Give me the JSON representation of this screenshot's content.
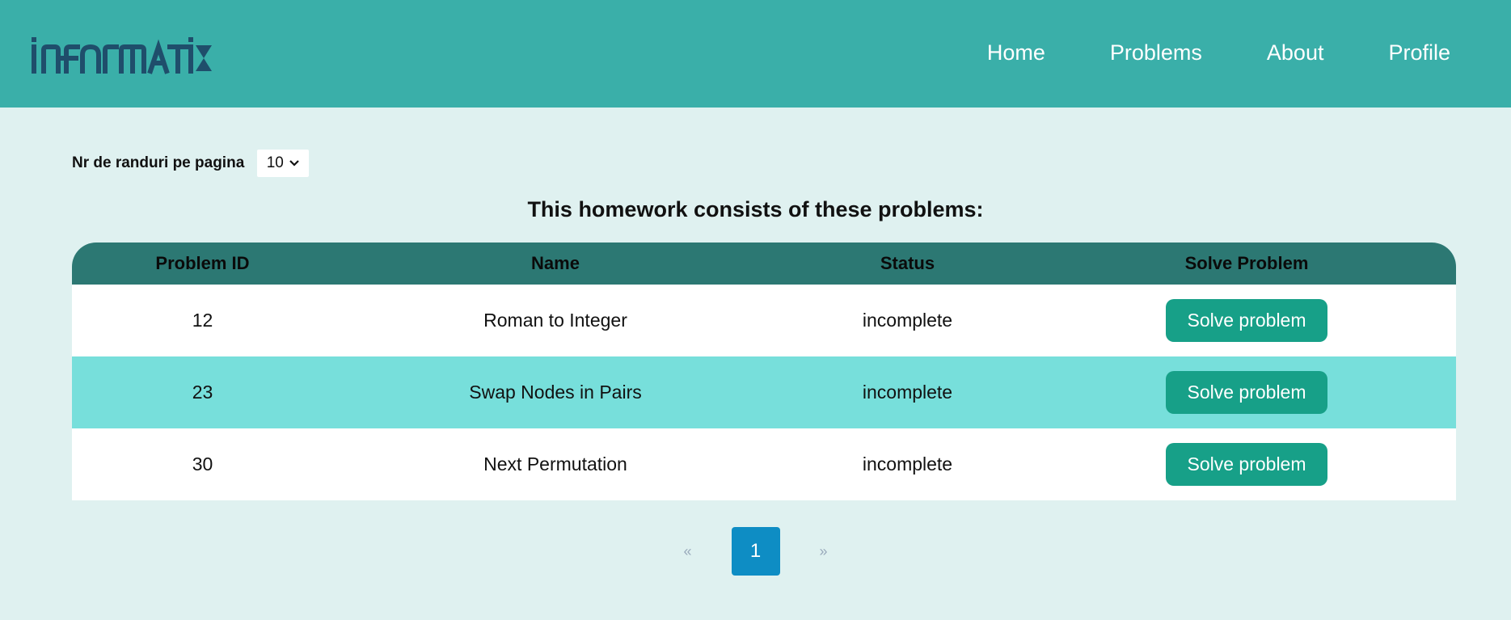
{
  "brand": {
    "logo_text": "informatix"
  },
  "nav": {
    "items": [
      {
        "label": "Home"
      },
      {
        "label": "Problems"
      },
      {
        "label": "About"
      },
      {
        "label": "Profile"
      }
    ]
  },
  "rows_per_page": {
    "label": "Nr de randuri pe pagina",
    "selected": "10"
  },
  "heading": "This homework consists of these problems:",
  "table": {
    "columns": [
      "Problem ID",
      "Name",
      "Status",
      "Solve Problem"
    ],
    "rows": [
      {
        "id": "12",
        "name": "Roman to Integer",
        "status": "incomplete",
        "action": "Solve problem"
      },
      {
        "id": "23",
        "name": "Swap Nodes in Pairs",
        "status": "incomplete",
        "action": "Solve problem"
      },
      {
        "id": "30",
        "name": "Next Permutation",
        "status": "incomplete",
        "action": "Solve problem"
      }
    ]
  },
  "pagination": {
    "prev": "«",
    "current": "1",
    "next": "»"
  },
  "colors": {
    "navbar": "#3aafa9",
    "page_bg": "#dff1f0",
    "table_header": "#2c7873",
    "row_alt": "#77dfdb",
    "button": "#17a088",
    "page_active": "#0e8dc4",
    "logo": "#1f4e6b"
  }
}
